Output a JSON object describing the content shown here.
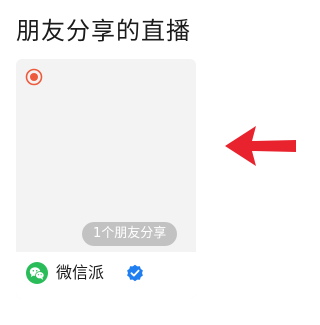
{
  "section": {
    "title": "朋友分享的直播"
  },
  "live_card": {
    "share_count_label": "1个朋友分享",
    "author_name": "微信派",
    "verified": true,
    "icons": {
      "live": "live-record-icon",
      "avatar": "wechat-logo-icon",
      "verified": "verified-badge-icon"
    }
  },
  "annotation": {
    "arrow_icon": "arrow-left-icon"
  },
  "colors": {
    "live_indicator": "#ed5b3c",
    "wechat_green": "#2bbc5a",
    "verified_blue": "#1f7ef0",
    "annotation_red": "#e8232e",
    "card_background": "#f3f3f3",
    "badge_background": "#c2c2c2"
  }
}
